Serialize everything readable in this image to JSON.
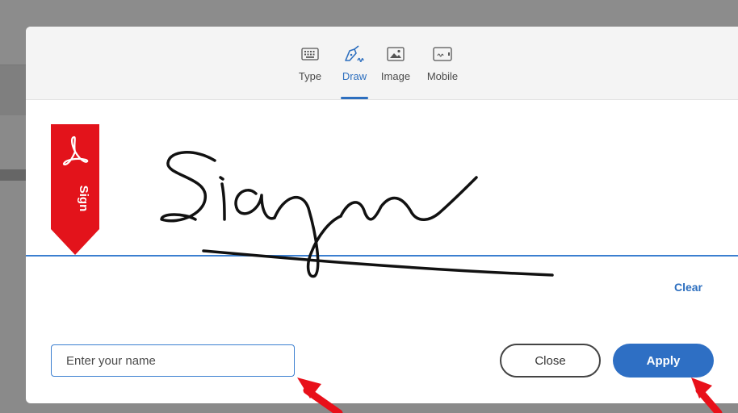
{
  "tabs": [
    {
      "label": "Type",
      "icon": "keyboard-icon"
    },
    {
      "label": "Draw",
      "icon": "pen-draw-icon",
      "active": true
    },
    {
      "label": "Image",
      "icon": "image-icon"
    },
    {
      "label": "Mobile",
      "icon": "mobile-device-icon"
    }
  ],
  "ribbon": {
    "label": "Sign",
    "icon": "acrobat-logo-icon",
    "color": "#e3131b"
  },
  "drawing": {
    "signature_text": "Sign",
    "stroke_color": "#111111",
    "baseline_color": "#3b7fd0"
  },
  "actions": {
    "clear_label": "Clear",
    "close_label": "Close",
    "apply_label": "Apply"
  },
  "name_input": {
    "placeholder": "Enter your name",
    "value": ""
  },
  "colors": {
    "accent": "#2e6fc4",
    "annotation_arrow": "#e8101a"
  }
}
